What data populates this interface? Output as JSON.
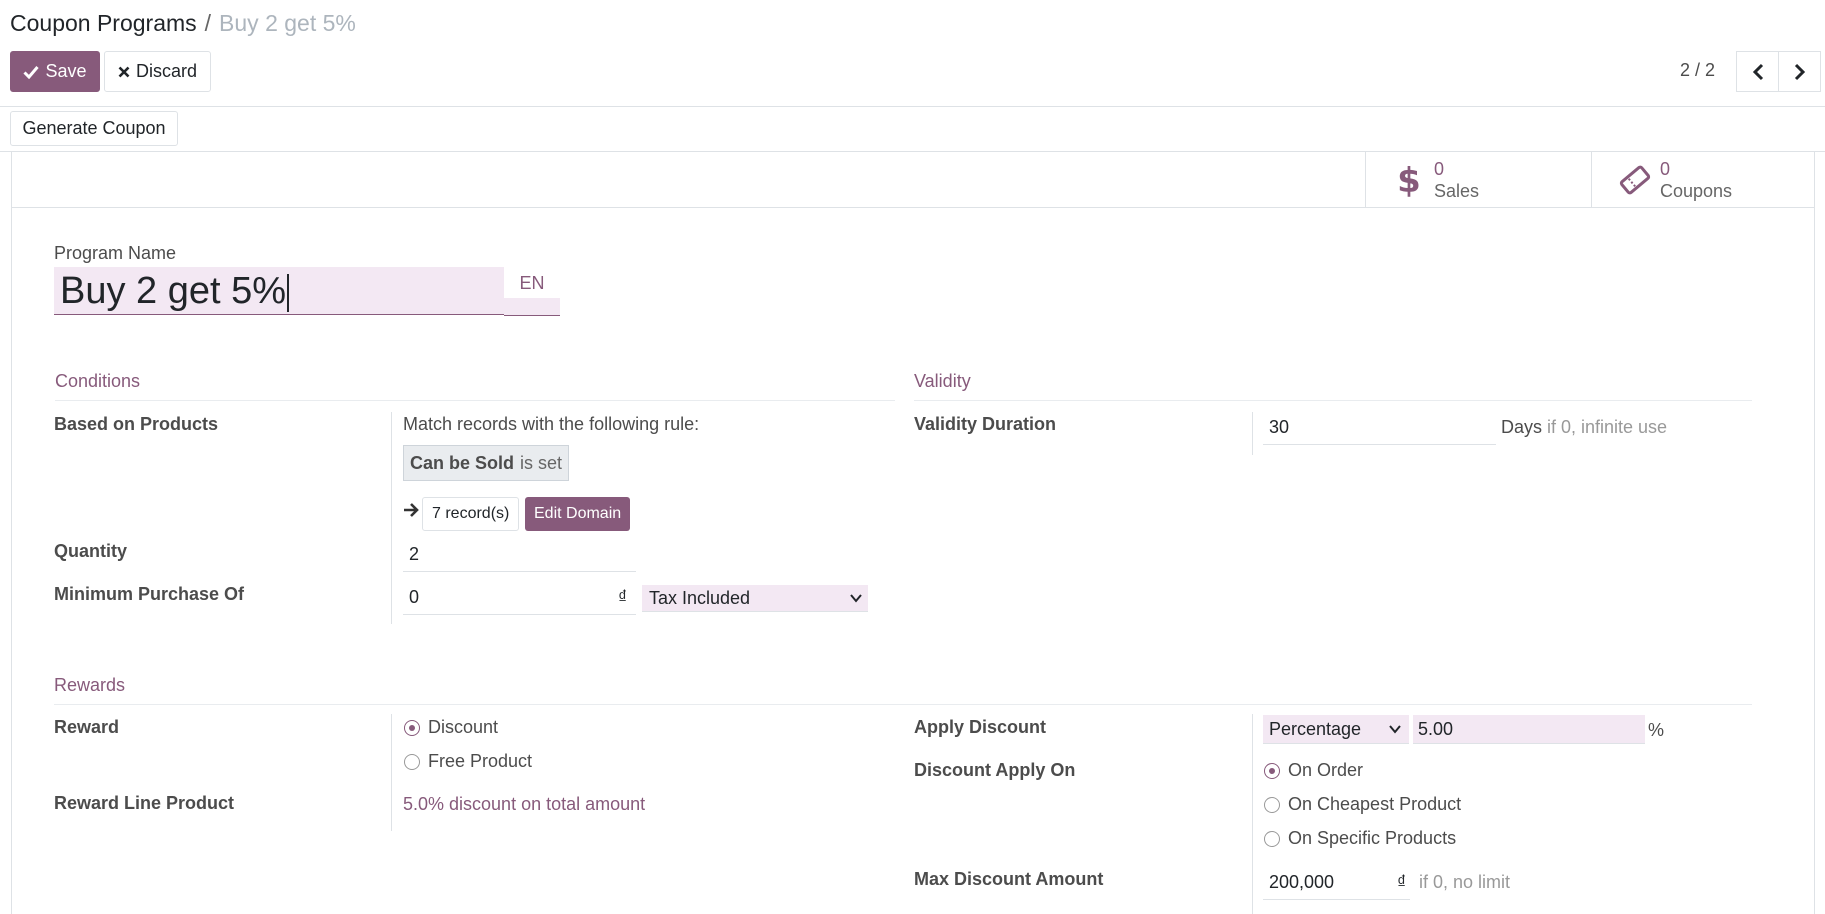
{
  "breadcrumb": {
    "parent": "Coupon Programs",
    "separator": "/",
    "current": "Buy 2 get 5%"
  },
  "toolbar": {
    "save_label": "Save",
    "discard_label": "Discard",
    "generate_label": "Generate Coupon"
  },
  "pager": {
    "value": "2 / 2"
  },
  "stats": {
    "sales_count": "0",
    "sales_label": "Sales",
    "coupons_count": "0",
    "coupons_label": "Coupons"
  },
  "program": {
    "name_label": "Program Name",
    "name_value": "Buy 2 get 5%",
    "lang": "EN"
  },
  "conditions": {
    "title": "Conditions",
    "based_label": "Based on Products",
    "rule_text": "Match records with the following rule:",
    "domain_field": "Can be Sold",
    "domain_op": "is set",
    "records": "7 record(s)",
    "edit_domain": "Edit Domain",
    "quantity_label": "Quantity",
    "quantity_value": "2",
    "min_label": "Minimum Purchase Of",
    "min_value": "0",
    "currency": "₫",
    "tax_value": "Tax Included"
  },
  "validity": {
    "title": "Validity",
    "duration_label": "Validity Duration",
    "duration_value": "30",
    "unit": "Days",
    "hint": "if 0, infinite use"
  },
  "rewards": {
    "title": "Rewards",
    "reward_label": "Reward",
    "opt_discount": "Discount",
    "opt_free": "Free Product",
    "line_label": "Reward Line Product",
    "line_value": "5.0% discount on total amount",
    "apply_label": "Apply Discount",
    "apply_type": "Percentage",
    "apply_value": "5.00",
    "percent": "%",
    "on_label": "Discount Apply On",
    "on_order": "On Order",
    "on_cheapest": "On Cheapest Product",
    "on_specific": "On Specific Products",
    "max_label": "Max Discount Amount",
    "max_value": "200,000",
    "currency": "₫",
    "max_hint": "if 0, no limit"
  },
  "colors": {
    "brand": "#875a7b",
    "field_bg": "#f3e8f3"
  }
}
